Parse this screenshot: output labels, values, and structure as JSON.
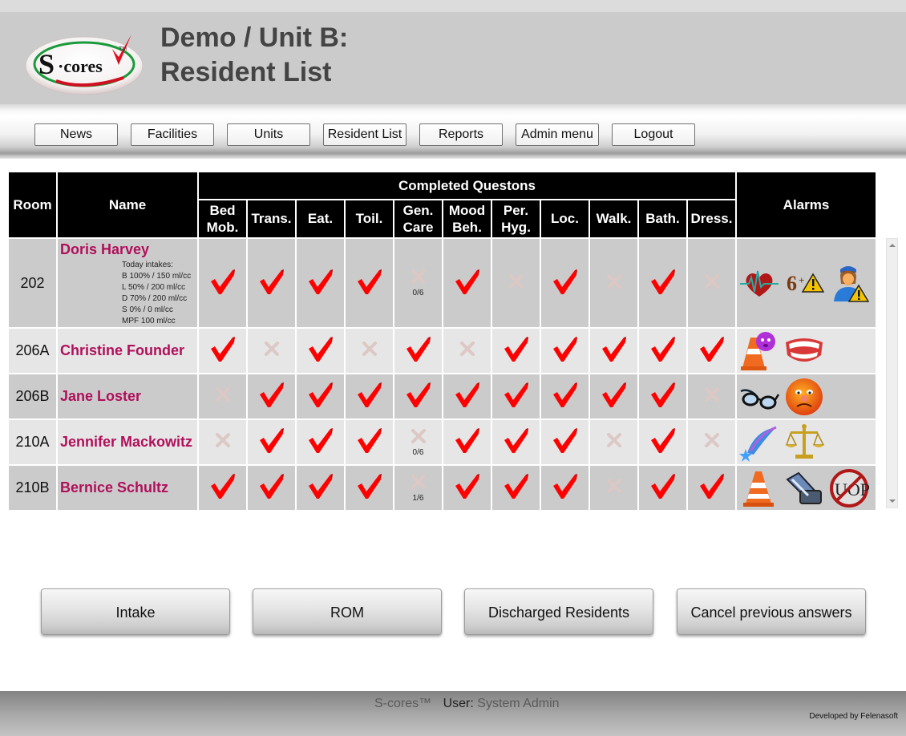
{
  "header": {
    "title_line1": "Demo / Unit B:",
    "title_line2": "Resident List",
    "logo_text": "S·cores",
    "logo_tm": "TM"
  },
  "nav": [
    {
      "label": "News"
    },
    {
      "label": "Facilities"
    },
    {
      "label": "Units"
    },
    {
      "label": "Resident List"
    },
    {
      "label": "Reports"
    },
    {
      "label": "Admin menu"
    },
    {
      "label": "Logout"
    }
  ],
  "table": {
    "headers": {
      "room": "Room",
      "name": "Name",
      "group": "Completed Questons",
      "alarms": "Alarms"
    },
    "question_columns": [
      {
        "line1": "Bed",
        "line2": "Mob."
      },
      {
        "line1": "Trans.",
        "line2": ""
      },
      {
        "line1": "Eat.",
        "line2": ""
      },
      {
        "line1": "Toil.",
        "line2": ""
      },
      {
        "line1": "Gen.",
        "line2": "Care"
      },
      {
        "line1": "Mood",
        "line2": "Beh."
      },
      {
        "line1": "Per.",
        "line2": "Hyg."
      },
      {
        "line1": "Loc.",
        "line2": ""
      },
      {
        "line1": "Walk.",
        "line2": ""
      },
      {
        "line1": "Bath.",
        "line2": ""
      },
      {
        "line1": "Dress.",
        "line2": ""
      }
    ],
    "rows": [
      {
        "room": "202",
        "name": "Doris Harvey",
        "intakes_title": "Today intakes:",
        "intakes": [
          "B 100% / 150 ml/cc",
          "L 50% / 200 ml/cc",
          "D 70% / 200 ml/cc",
          "S 0% / 0 ml/cc",
          "MPF 100 ml/cc"
        ],
        "answers": [
          {
            "status": "check"
          },
          {
            "status": "check"
          },
          {
            "status": "check"
          },
          {
            "status": "check"
          },
          {
            "status": "x",
            "sub": "0/6"
          },
          {
            "status": "check"
          },
          {
            "status": "x"
          },
          {
            "status": "check"
          },
          {
            "status": "x"
          },
          {
            "status": "check"
          },
          {
            "status": "x"
          }
        ],
        "alarms": [
          "heart-rate-icon",
          "six-plus-warning-icon",
          "nurse-warning-icon"
        ]
      },
      {
        "room": "206A",
        "name": "Christine Founder",
        "answers": [
          {
            "status": "check"
          },
          {
            "status": "x"
          },
          {
            "status": "check"
          },
          {
            "status": "x"
          },
          {
            "status": "check"
          },
          {
            "status": "x"
          },
          {
            "status": "check"
          },
          {
            "status": "check"
          },
          {
            "status": "check"
          },
          {
            "status": "check"
          },
          {
            "status": "check"
          }
        ],
        "alarms": [
          "cone-dizzy-face-icon",
          "dentures-icon"
        ]
      },
      {
        "room": "206B",
        "name": "Jane Loster",
        "answers": [
          {
            "status": "x"
          },
          {
            "status": "check"
          },
          {
            "status": "check"
          },
          {
            "status": "check"
          },
          {
            "status": "check"
          },
          {
            "status": "check"
          },
          {
            "status": "check"
          },
          {
            "status": "check"
          },
          {
            "status": "check"
          },
          {
            "status": "check"
          },
          {
            "status": "x"
          }
        ],
        "alarms": [
          "glasses-icon",
          "sad-face-icon"
        ]
      },
      {
        "room": "210A",
        "name": "Jennifer Mackowitz",
        "answers": [
          {
            "status": "x"
          },
          {
            "status": "check"
          },
          {
            "status": "check"
          },
          {
            "status": "check"
          },
          {
            "status": "x",
            "sub": "0/6"
          },
          {
            "status": "check"
          },
          {
            "status": "check"
          },
          {
            "status": "check"
          },
          {
            "status": "x"
          },
          {
            "status": "check"
          },
          {
            "status": "x"
          }
        ],
        "alarms": [
          "shooting-star-icon",
          "scales-icon"
        ]
      },
      {
        "room": "210B",
        "name": "Bernice Schultz",
        "answers": [
          {
            "status": "check"
          },
          {
            "status": "check"
          },
          {
            "status": "check"
          },
          {
            "status": "check"
          },
          {
            "status": "x",
            "sub": "1/6"
          },
          {
            "status": "check"
          },
          {
            "status": "check"
          },
          {
            "status": "check"
          },
          {
            "status": "x"
          },
          {
            "status": "check"
          },
          {
            "status": "check"
          }
        ],
        "alarms": [
          "cone-icon",
          "wheelchair-icon",
          "no-uop-icon"
        ]
      }
    ]
  },
  "actions": [
    {
      "label": "Intake"
    },
    {
      "label": "ROM"
    },
    {
      "label": "Discharged Residents"
    },
    {
      "label": "Cancel previous answers"
    }
  ],
  "footer": {
    "brand": "S-cores™",
    "user_label": "User:",
    "user_name": "System Admin",
    "developer": "Developed by Felenasoft"
  },
  "colors": {
    "resident_name": "#b0105b",
    "check": "#ff0000",
    "x_mark": "#d9c4c0",
    "header_bg": "#000000"
  }
}
